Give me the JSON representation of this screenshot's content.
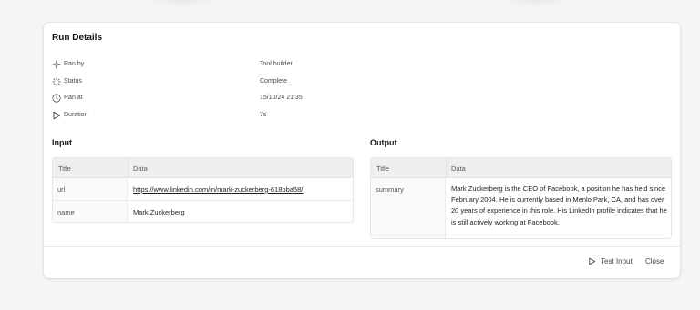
{
  "modal": {
    "title": "Run Details"
  },
  "meta": [
    {
      "icon": "sparkle-icon",
      "label": "Ran by",
      "value": "Tool builder"
    },
    {
      "icon": "loader-icon",
      "label": "Status",
      "value": "Complete"
    },
    {
      "icon": "clock-icon",
      "label": "Ran at",
      "value": "15/10/24 21:35"
    },
    {
      "icon": "play-icon",
      "label": "Duration",
      "value": "7s"
    }
  ],
  "input": {
    "heading": "Input",
    "columns": [
      "Title",
      "Data"
    ],
    "rows": [
      {
        "title": "url",
        "data": "https://www.linkedin.com/in/mark-zuckerberg-618bba58/"
      },
      {
        "title": "name",
        "data": "Mark Zuckerberg"
      }
    ]
  },
  "output": {
    "heading": "Output",
    "columns": [
      "Title",
      "Data"
    ],
    "rows": [
      {
        "title": "summary",
        "data": "Mark Zuckerberg is the CEO of Facebook, a position he has held since February 2004. He is currently based in Menlo Park, CA, and has over 20 years of experience in this role. His LinkedIn profile indicates that he is still actively working at Facebook."
      }
    ]
  },
  "footer": {
    "test_input_label": "Test Input",
    "close_label": "Close"
  },
  "colors": {
    "link": "#3b3bd8",
    "header_bg": "#efeff1"
  }
}
